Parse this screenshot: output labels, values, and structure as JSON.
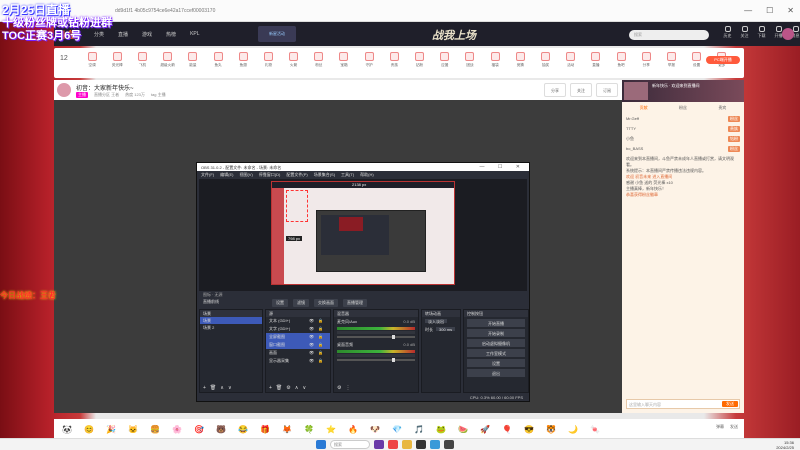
{
  "overlay": {
    "line1": "2月25日直播",
    "line2": "十级粉丝牌或钻粉进群",
    "line3": "TOC正赛3月6号",
    "side_note": "今日战绩：王者"
  },
  "browser": {
    "url": "dd9d1f1 4b05c9754ce6e42a17ccef00003170",
    "controls": [
      "—",
      "☐",
      "✕"
    ]
  },
  "site": {
    "logo": "斗鱼",
    "nav": [
      "分类",
      "直播",
      "游戏",
      "热榜",
      "KPL"
    ],
    "banner": "新星活动",
    "game_logo": "战我上场",
    "search_placeholder": "搜索",
    "header_icons": [
      "历史",
      "关注",
      "下载",
      "开播",
      "消息",
      "任务",
      "特权"
    ]
  },
  "gift_bar": {
    "count": "12",
    "items": [
      "空调",
      "荧光棒",
      "飞机",
      "超级火箭",
      "能量",
      "鱼丸",
      "鱼翅",
      "礼物",
      "火箭",
      "粉丝",
      "宝箱",
      "守护",
      "贵族",
      "钻粉",
      "应援",
      "团战",
      "福袋",
      "竞猜",
      "抽奖",
      "活动",
      "直播",
      "鱼吧",
      "分享",
      "举报",
      "设置",
      "更多"
    ],
    "pc_button": "PC端开播"
  },
  "stream": {
    "title": "初音：大家新年快乐~",
    "tag": "主播",
    "meta": [
      "直播分区 王者",
      "热度 123万",
      "tag 主播"
    ],
    "actions": [
      "分享",
      "关注",
      "订阅"
    ]
  },
  "obs": {
    "title": "OBS 31.0.2 - 配置文件: 未命名 - 场景: 未命名",
    "window_controls": "— ☐ ✕",
    "menu": [
      "文件(F)",
      "编辑(E)",
      "视图(V)",
      "停靠窗口(D)",
      "配置文件(P)",
      "场景集合(S)",
      "工具(T)",
      "帮助(H)"
    ],
    "preview_size": "798 px",
    "preview_top": "2138 px",
    "strip": "图标 · 无源",
    "ctrl_label": "直播前线",
    "ctrl_buttons": [
      "设置",
      "滤镜",
      "交换画面",
      "直播管理"
    ],
    "scenes_header": "场景",
    "scenes": [
      "场景",
      "场景 2"
    ],
    "sources_header": "源",
    "sources": [
      "文本 (GDI+)",
      "文字 (GDI+)",
      "全屏截图",
      "窗口截图",
      "画面",
      "显示器采集"
    ],
    "mixer_header": "混音器",
    "mixer": [
      {
        "name": "麦克风/Aux",
        "db": "0.0 dB"
      },
      {
        "name": "桌面音频",
        "db": "0.0 dB"
      }
    ],
    "trans_header": "转场动画",
    "trans": [
      "淡入淡出",
      "时长",
      "300 ms"
    ],
    "controls_header": "控制按钮",
    "controls": [
      "开始直播",
      "开始录制",
      "启动虚拟摄像机",
      "工作室模式",
      "设置",
      "退出"
    ],
    "status": "CPU: 0.3%   60.00 / 60.00 FPS"
  },
  "emotes": {
    "items": [
      "🐼",
      "😊",
      "🎉",
      "🐱",
      "🍔",
      "🌸",
      "🎯",
      "🐻",
      "😂",
      "🎁",
      "🦊",
      "🍀",
      "⭐",
      "🔥",
      "🐶",
      "💎",
      "🎵",
      "🐸",
      "🍉",
      "🚀",
      "🎈",
      "😎",
      "🐯",
      "🌙",
      "🍬"
    ],
    "end": [
      "弹幕",
      "发送"
    ]
  },
  "chat": {
    "banner": "新年快乐 · 欢迎来到直播间",
    "tabs": [
      "贡献",
      "粉丝",
      "贵宾"
    ],
    "ranks": [
      {
        "name": "Mr.Geff",
        "badge": "粉丝"
      },
      {
        "name": "TTTY",
        "badge": "贵族"
      },
      {
        "name": "小鱼",
        "badge": "钻粉"
      },
      {
        "name": "bo_BASS",
        "badge": "粉丝"
      }
    ],
    "messages": [
      "欢迎来到本直播间，斗鱼严禁未成年人直播或打赏，请文明观看。",
      "系统提示：本直播间严禁传播违法违规内容。",
      "欢迎 初音未来 进入直播间",
      "感谢 小鱼 送的 荧光棒 x10",
      "主播真棒，新年快乐！",
      "恭喜获得粉丝徽章"
    ],
    "input_placeholder": "这里输入聊天内容",
    "send": "发送"
  },
  "taskbar": {
    "search": "搜索",
    "time": "15:36",
    "date": "2024/2/25"
  }
}
